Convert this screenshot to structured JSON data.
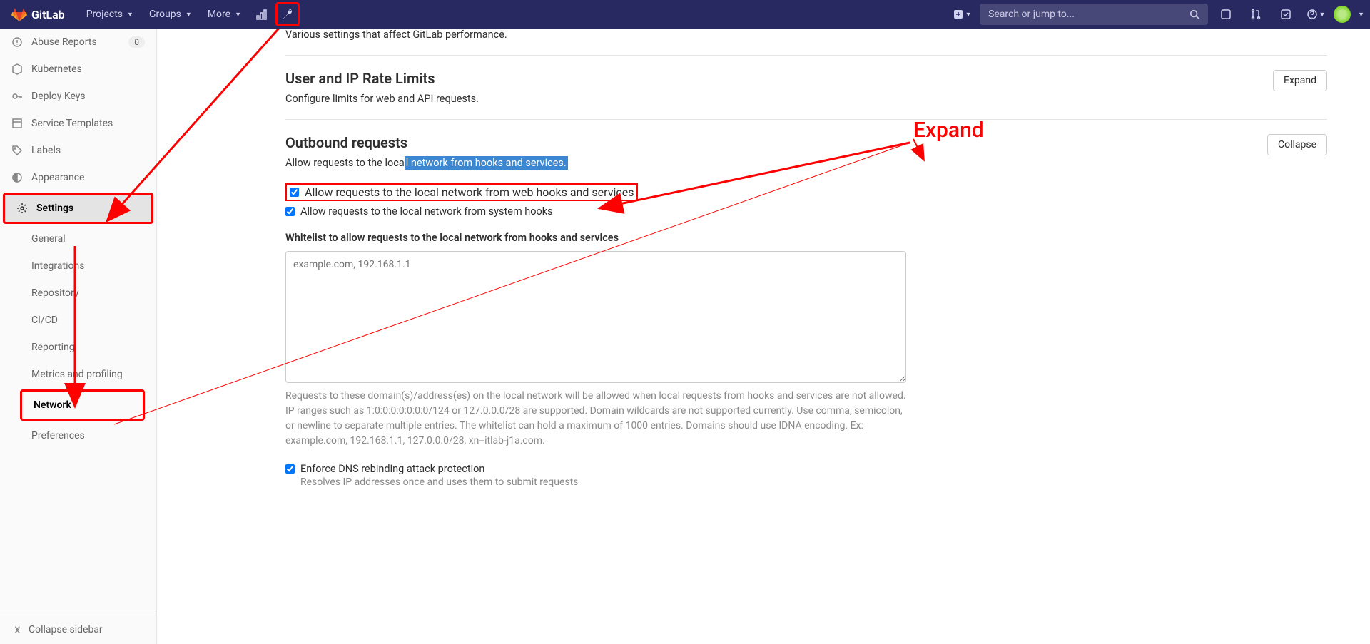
{
  "brand": "GitLab",
  "topnav": {
    "projects": "Projects",
    "groups": "Groups",
    "more": "More"
  },
  "search": {
    "placeholder": "Search or jump to..."
  },
  "sidebar": {
    "items": [
      {
        "label": "Abuse Reports",
        "badge": "0"
      },
      {
        "label": "Kubernetes"
      },
      {
        "label": "Deploy Keys"
      },
      {
        "label": "Service Templates"
      },
      {
        "label": "Labels"
      },
      {
        "label": "Appearance"
      },
      {
        "label": "Settings"
      }
    ],
    "sub": {
      "general": "General",
      "integrations": "Integrations",
      "repository": "Repository",
      "cicd": "CI/CD",
      "reporting": "Reporting",
      "metrics": "Metrics and profiling",
      "network": "Network",
      "preferences": "Preferences"
    },
    "collapse": "Collapse sidebar"
  },
  "sections": {
    "perf": {
      "desc": "Various settings that affect GitLab performance."
    },
    "ratelimits": {
      "title": "User and IP Rate Limits",
      "desc": "Configure limits for web and API requests.",
      "btn": "Expand"
    },
    "outbound": {
      "title": "Outbound requests",
      "desc_prefix": "Allow requests to the loca",
      "desc_highlight": "l network from hooks and services.",
      "btn": "Collapse",
      "check_web": "Allow requests to the local network from web hooks and services",
      "check_sys": "Allow requests to the local network from system hooks",
      "whitelist_label": "Whitelist to allow requests to the local network from hooks and services",
      "whitelist_placeholder": "example.com, 192.168.1.1",
      "whitelist_help": "Requests to these domain(s)/address(es) on the local network will be allowed when local requests from hooks and services are not allowed. IP ranges such as 1:0:0:0:0:0:0:0/124 or 127.0.0.0/28 are supported. Domain wildcards are not supported currently. Use comma, semicolon, or newline to separate multiple entries. The whitelist can hold a maximum of 1000 entries. Domains should use IDNA encoding. Ex: example.com, 192.168.1.1, 127.0.0.0/28, xn--itlab-j1a.com.",
      "dns_label": "Enforce DNS rebinding attack protection",
      "dns_help": "Resolves IP addresses once and uses them to submit requests"
    }
  },
  "annotations": {
    "expand_label": "Expand"
  }
}
